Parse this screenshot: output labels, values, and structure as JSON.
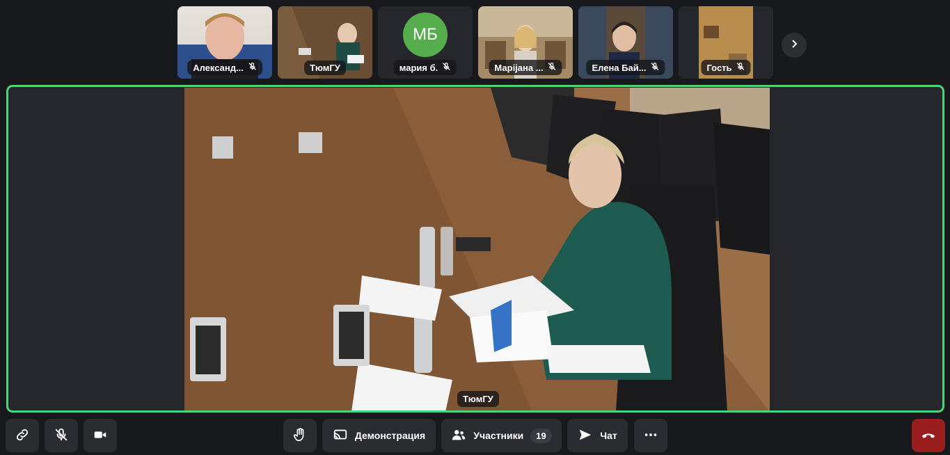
{
  "participants": [
    {
      "name": "Александ...",
      "muted": true,
      "active": false
    },
    {
      "name": "ТюмГУ",
      "muted": false,
      "active": true
    },
    {
      "name": "мария б.",
      "muted": true,
      "active": false,
      "initials": "МБ",
      "avatar_color": "#55ad4e"
    },
    {
      "name": "Марijана ...",
      "muted": true,
      "active": false
    },
    {
      "name": "Елена Бай...",
      "muted": true,
      "active": false
    },
    {
      "name": "Гость",
      "muted": true,
      "active": false
    }
  ],
  "stage": {
    "speaker_name": "ТюмГУ"
  },
  "toolbar": {
    "screen_share_label": "Демонстрация",
    "participants_label": "Участники",
    "participants_count": "19",
    "chat_label": "Чат"
  },
  "colors": {
    "active_border": "#4cd47a",
    "hangup": "#9b1e1e",
    "background": "#18191d"
  }
}
